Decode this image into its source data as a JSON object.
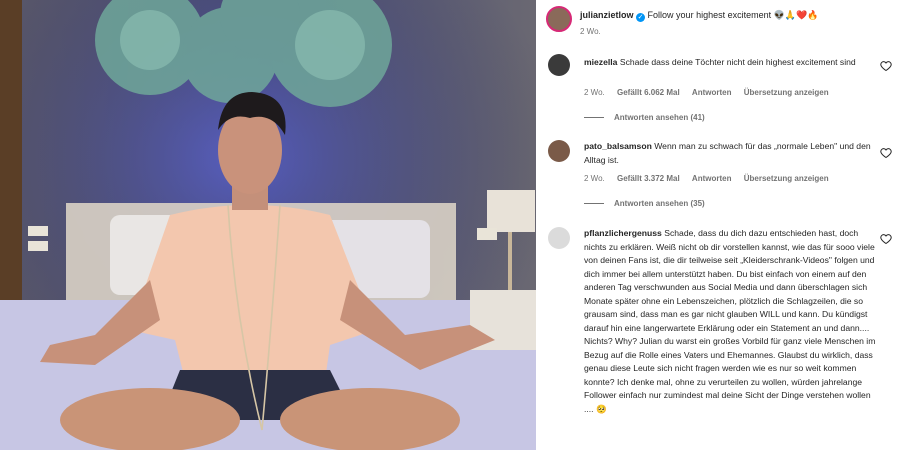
{
  "post": {
    "author": "julianzietlow",
    "caption": "Follow your highest excitement 👽🙏❤️🔥",
    "age": "2 Wo."
  },
  "comments": [
    {
      "user": "miezella",
      "text": "Schade dass deine Töchter nicht dein highest excitement sind",
      "age": "2 Wo.",
      "likes": "Gefällt 6.062 Mal",
      "reply": "Antworten",
      "translate": "Übersetzung anzeigen",
      "view_replies": "Antworten ansehen (41)"
    },
    {
      "user": "pato_balsamson",
      "text": "Wenn man zu schwach für das „normale Leben\" und den Alltag ist.",
      "age": "2 Wo.",
      "likes": "Gefällt 3.372 Mal",
      "reply": "Antworten",
      "translate": "Übersetzung anzeigen",
      "view_replies": "Antworten ansehen (35)"
    },
    {
      "user": "pflanzlichergenuss",
      "text": "Schade, dass du dich dazu entschieden hast, doch nichts zu erklären. Weiß nicht ob dir vorstellen kannst, wie das für sooo viele von deinen Fans ist, die dir teilweise seit „Kleiderschrank-Videos\" folgen und dich immer bei allem unterstützt haben. Du bist einfach von einem auf den anderen Tag verschwunden aus Social Media und dann überschlagen sich Monate später ohne ein Lebenszeichen, plötzlich die Schlagzeilen, die so grausam sind, dass man es gar nicht glauben WILL und kann. Du kündigst darauf hin eine langerwartete Erklärung oder ein Statement an und dann.... Nichts? Why? Julian du warst ein großes Vorbild für ganz viele Menschen im Bezug auf die Rolle eines Vaters und Ehemannes. Glaubst du wirklich, dass genau diese Leute sich nicht fragen werden wie es nur so weit kommen konnte? Ich denke mal, ohne zu verurteilen zu wollen, würden jahrelange Follower einfach nur zumindest mal deine Sicht der Dinge verstehen wollen .... 🥺"
    }
  ],
  "colors": {
    "verified": "#0095f6",
    "meta": "#737373",
    "text": "#262626"
  }
}
